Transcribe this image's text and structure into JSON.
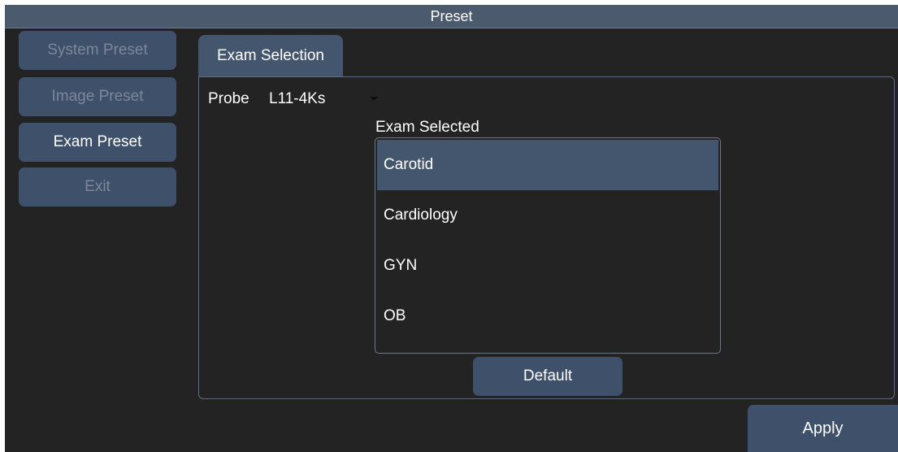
{
  "window": {
    "title": "Preset"
  },
  "sidebar": {
    "items": [
      {
        "label": "System Preset",
        "state": "disabled"
      },
      {
        "label": "Image Preset",
        "state": "disabled"
      },
      {
        "label": "Exam Preset",
        "state": "active"
      },
      {
        "label": "Exit",
        "state": "disabled"
      }
    ]
  },
  "tabs": [
    {
      "label": "Exam Selection"
    }
  ],
  "probe": {
    "label": "Probe",
    "value": "L11-4Ks",
    "icon": "dropdown-arrow-icon"
  },
  "exam_list": {
    "heading": "Exam Selected",
    "items": [
      "Carotid",
      "Cardiology",
      "GYN",
      "OB"
    ],
    "selected": "Carotid"
  },
  "buttons": {
    "default_label": "Default",
    "apply_label": "Apply"
  },
  "colors": {
    "background": "#232324",
    "titlebar": "#4b5a6d",
    "button": "#3e506a",
    "selected": "#44566e",
    "disabled_text": "#7c8798"
  }
}
